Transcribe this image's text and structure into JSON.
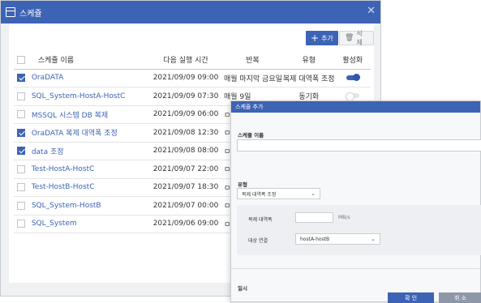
{
  "window": {
    "title": "스케쥴"
  },
  "toolbar": {
    "add_label": "추가",
    "delete_label": "삭제"
  },
  "table": {
    "headers": [
      "스케쥴 이름",
      "다음 실행 시간",
      "반복",
      "유형",
      "활성화"
    ],
    "rows": [
      {
        "checked": true,
        "name": "OraDATA",
        "next_run": "2021/09/09 09:00",
        "repeat": "매월 마지막 금요일",
        "type": "복제 대역폭 조정",
        "enabled": true
      },
      {
        "checked": false,
        "name": "SQL_System-HostA-HostC",
        "next_run": "2021/09/09 07:30",
        "repeat": "매월 9일",
        "type": "동기화",
        "enabled": false
      },
      {
        "checked": false,
        "name": "MSSQL 시스템 DB 복제",
        "next_run": "2021/09/09 06:00",
        "repeat": "ㅁ",
        "type": "",
        "enabled": null
      },
      {
        "checked": true,
        "name": "OraDATA 복제 대역폭 조정",
        "next_run": "2021/09/08 12:30",
        "repeat": "ㅁ",
        "type": "",
        "enabled": null
      },
      {
        "checked": true,
        "name": "data 조정",
        "next_run": "2021/09/08 08:00",
        "repeat": "ㅁ",
        "type": "",
        "enabled": null
      },
      {
        "checked": false,
        "name": "Test-HostA-HostC",
        "next_run": "2021/09/07 22:00",
        "repeat": "ㅁ",
        "type": "",
        "enabled": null
      },
      {
        "checked": false,
        "name": "Test-HostB-HostC",
        "next_run": "2021/09/07 18:30",
        "repeat": "ㅁ",
        "type": "",
        "enabled": null
      },
      {
        "checked": false,
        "name": "SQL_System-HostB",
        "next_run": "2021/09/07 00:00",
        "repeat": "ㅁ",
        "type": "",
        "enabled": null
      },
      {
        "checked": false,
        "name": "SQL_System",
        "next_run": "2021/09/06 09:00",
        "repeat": "ㅁ",
        "type": "",
        "enabled": null
      }
    ]
  },
  "dialog": {
    "title": "스케쥴 추가",
    "name_label": "스케쥴 이름",
    "name_value": "",
    "type_label": "유형",
    "type_value": "복제 대역폭 조정",
    "bandwidth_label": "복제 대역폭",
    "bandwidth_value": "",
    "bandwidth_unit": "MB/s",
    "target_label": "대상 연결",
    "target_value": "hostA-hostB",
    "schedule_label": "일시",
    "ok_label": "확 인",
    "cancel_label": "취 소"
  },
  "colors": {
    "accent": "#3d63b4",
    "cancel": "#8e97a8"
  }
}
